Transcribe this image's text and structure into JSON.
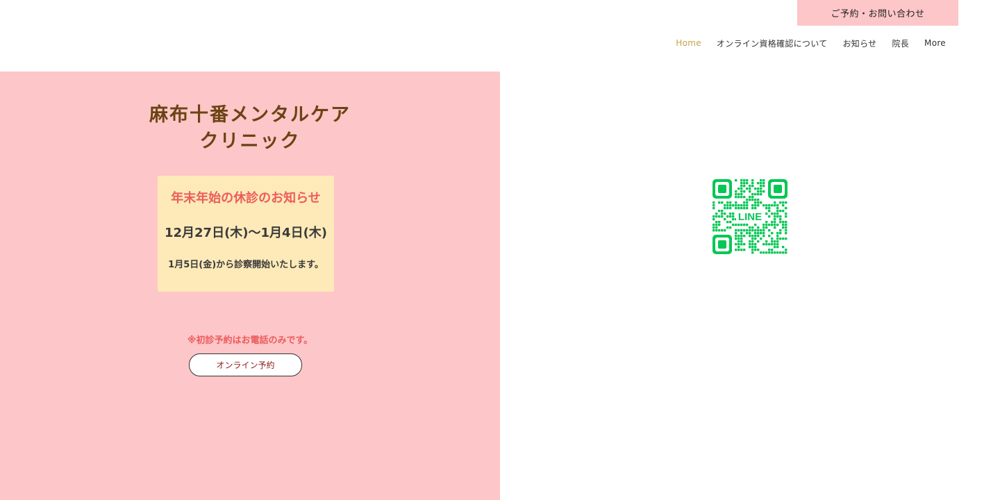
{
  "header": {
    "reserve_label": "ご予約・お問い合わせ",
    "nav": [
      {
        "label": "Home",
        "active": true
      },
      {
        "label": "オンライン資格確認について",
        "active": false
      },
      {
        "label": "お知らせ",
        "active": false
      },
      {
        "label": "院長",
        "active": false
      },
      {
        "label": "More",
        "active": false
      }
    ]
  },
  "hero": {
    "title_line1": "麻布十番メンタルケア",
    "title_line2": "クリニック",
    "notice": {
      "heading": "年末年始の休診のお知らせ",
      "dates": "12月27日(木)〜1月4日(木)",
      "resume": "1月5日(金)から診察開始いたします。"
    },
    "first_visit_note": "※初診予約はお電話のみです。",
    "online_button": "オンライン予約"
  },
  "qr": {
    "label": "LINE",
    "color": "#06c755"
  },
  "colors": {
    "pink": "#fdc6c8",
    "notice_bg": "#fdeab8",
    "title_brown": "#6b4314",
    "accent_red": "#ec5c5c",
    "nav_active": "#c8a04a"
  }
}
